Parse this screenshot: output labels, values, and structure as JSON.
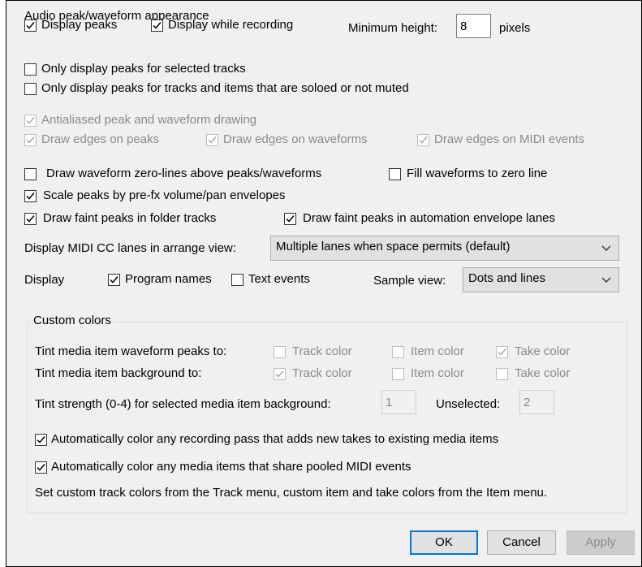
{
  "group_audio": {
    "title": "Audio peak/waveform appearance"
  },
  "display_peaks": {
    "label": "Display peaks",
    "checked": true
  },
  "display_while_recording": {
    "label": "Display while recording",
    "checked": true
  },
  "minimum_height": {
    "label": "Minimum height:",
    "value": "8",
    "unit": "pixels"
  },
  "only_selected": {
    "label": "Only display peaks for selected tracks",
    "checked": false
  },
  "only_soloed": {
    "label": "Only display peaks for tracks and items that are soloed or not muted",
    "checked": false
  },
  "antialiased": {
    "label": "Antialiased peak and waveform drawing",
    "checked": true
  },
  "edges_peaks": {
    "label": "Draw edges on peaks",
    "checked": true
  },
  "edges_waveforms": {
    "label": "Draw edges on waveforms",
    "checked": true
  },
  "edges_midi": {
    "label": "Draw edges on MIDI events",
    "checked": true
  },
  "zero_lines": {
    "label": "Draw waveform zero-lines above peaks/waveforms",
    "checked": false
  },
  "fill_zero": {
    "label": "Fill waveforms to zero line",
    "checked": false
  },
  "scale_peaks": {
    "label": "Scale peaks by pre-fx volume/pan envelopes",
    "checked": true
  },
  "faint_folder": {
    "label": "Draw faint peaks in folder tracks",
    "checked": true
  },
  "faint_automation": {
    "label": "Draw faint peaks in automation envelope lanes",
    "checked": true
  },
  "midi_cc": {
    "label": "Display MIDI CC lanes in arrange view:",
    "selected": "Multiple lanes when space permits (default)"
  },
  "display_row": {
    "label": "Display"
  },
  "program_names": {
    "label": "Program names",
    "checked": true
  },
  "text_events": {
    "label": "Text events",
    "checked": false
  },
  "sample_view": {
    "label": "Sample view:",
    "selected": "Dots and lines"
  },
  "group_custom": {
    "title": "Custom colors"
  },
  "tint_peaks": {
    "label": "Tint media item waveform peaks to:",
    "track": {
      "label": "Track color",
      "checked": false
    },
    "item": {
      "label": "Item color",
      "checked": false
    },
    "take": {
      "label": "Take color",
      "checked": true
    }
  },
  "tint_bg": {
    "label": "Tint media item background to:",
    "track": {
      "label": "Track color",
      "checked": true
    },
    "item": {
      "label": "Item color",
      "checked": false
    },
    "take": {
      "label": "Take color",
      "checked": false
    }
  },
  "tint_strength": {
    "label": "Tint strength (0-4) for selected media item background:",
    "value": "1",
    "unselected_label": "Unselected:",
    "unselected_value": "2"
  },
  "auto_color_recording": {
    "label": "Automatically color any recording pass that adds new takes to existing media items",
    "checked": true
  },
  "auto_color_pooled": {
    "label": "Automatically color any media items that share pooled MIDI events",
    "checked": true
  },
  "hint": "Set custom track colors from the Track menu, custom item and take colors from the Item menu.",
  "buttons": {
    "ok": "OK",
    "cancel": "Cancel",
    "apply": "Apply"
  },
  "colors": {
    "accent": "#0078d7",
    "disabled_text": "#8a8a8a"
  }
}
